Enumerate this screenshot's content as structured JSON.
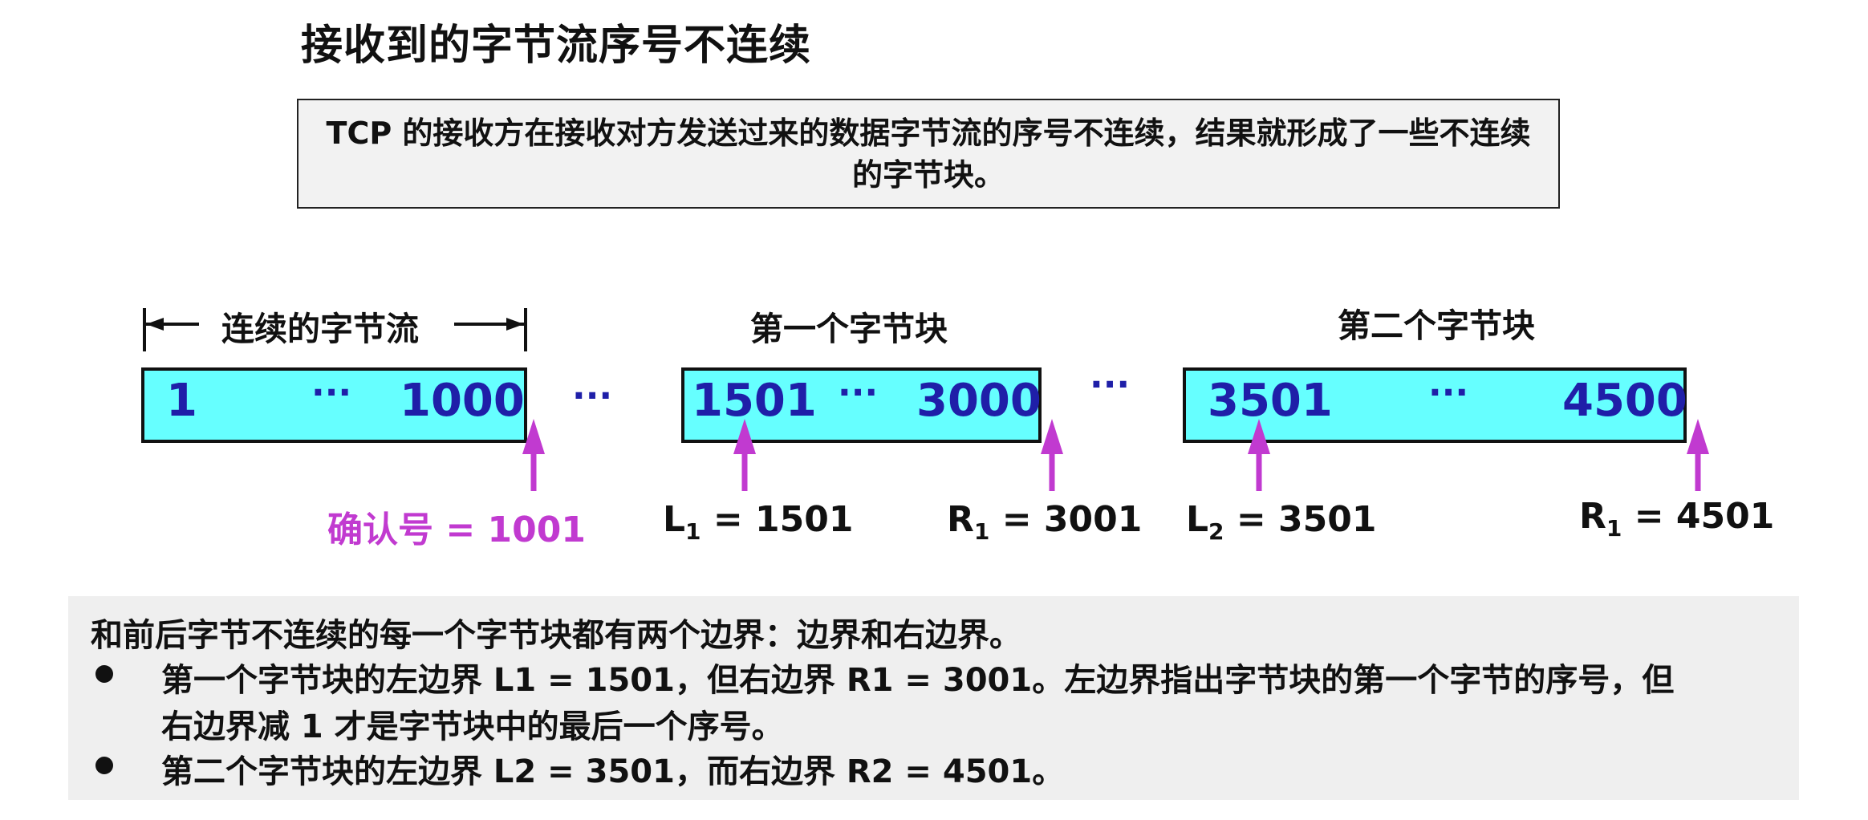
{
  "title": "接收到的字节流序号不连续",
  "intro": "TCP 的接收方在接收对方发送过来的数据字节流的序号不连续，结果就形成了一些不连续的字节块。",
  "headers": {
    "continuous": "连续的字节流",
    "block1": "第一个字节块",
    "block2": "第二个字节块"
  },
  "boxes": {
    "continuous": {
      "start": "1",
      "mid": "···",
      "end": "1000"
    },
    "block1": {
      "start": "1501",
      "mid": "···",
      "end": "3000"
    },
    "block2": {
      "start": "3501",
      "mid": "···",
      "end": "4500"
    }
  },
  "gap_dots": [
    "···",
    "···"
  ],
  "labels": {
    "ack": "确认号 = 1001",
    "l1_letter": "L",
    "l1_sub": "1",
    "l1_value": " = 1501",
    "r1_letter": "R",
    "r1_sub": "1",
    "r1_value": " = 3001",
    "l2_letter": "L",
    "l2_sub": "2",
    "l2_value": " = 3501",
    "r2_letter": "R",
    "r2_sub": "1",
    "r2_value": " = 4501"
  },
  "notes": {
    "lead": "和前后字节不连续的每一个字节块都有两个边界：边界和右边界。",
    "bullet1_line1": "第一个字节块的左边界 L1 = 1501，但右边界 R1 = 3001。左边界指出字节块的第一个字节的序号，但",
    "bullet1_line2": "右边界减 1 才是字节块中的最后一个序号。",
    "bullet2": "第二个字节块的左边界 L2 = 3501，而右边界 R2 = 4501。"
  },
  "colors": {
    "box_fill": "#66ffff",
    "number": "#1f1fa8",
    "arrow": "#c13ad0"
  }
}
